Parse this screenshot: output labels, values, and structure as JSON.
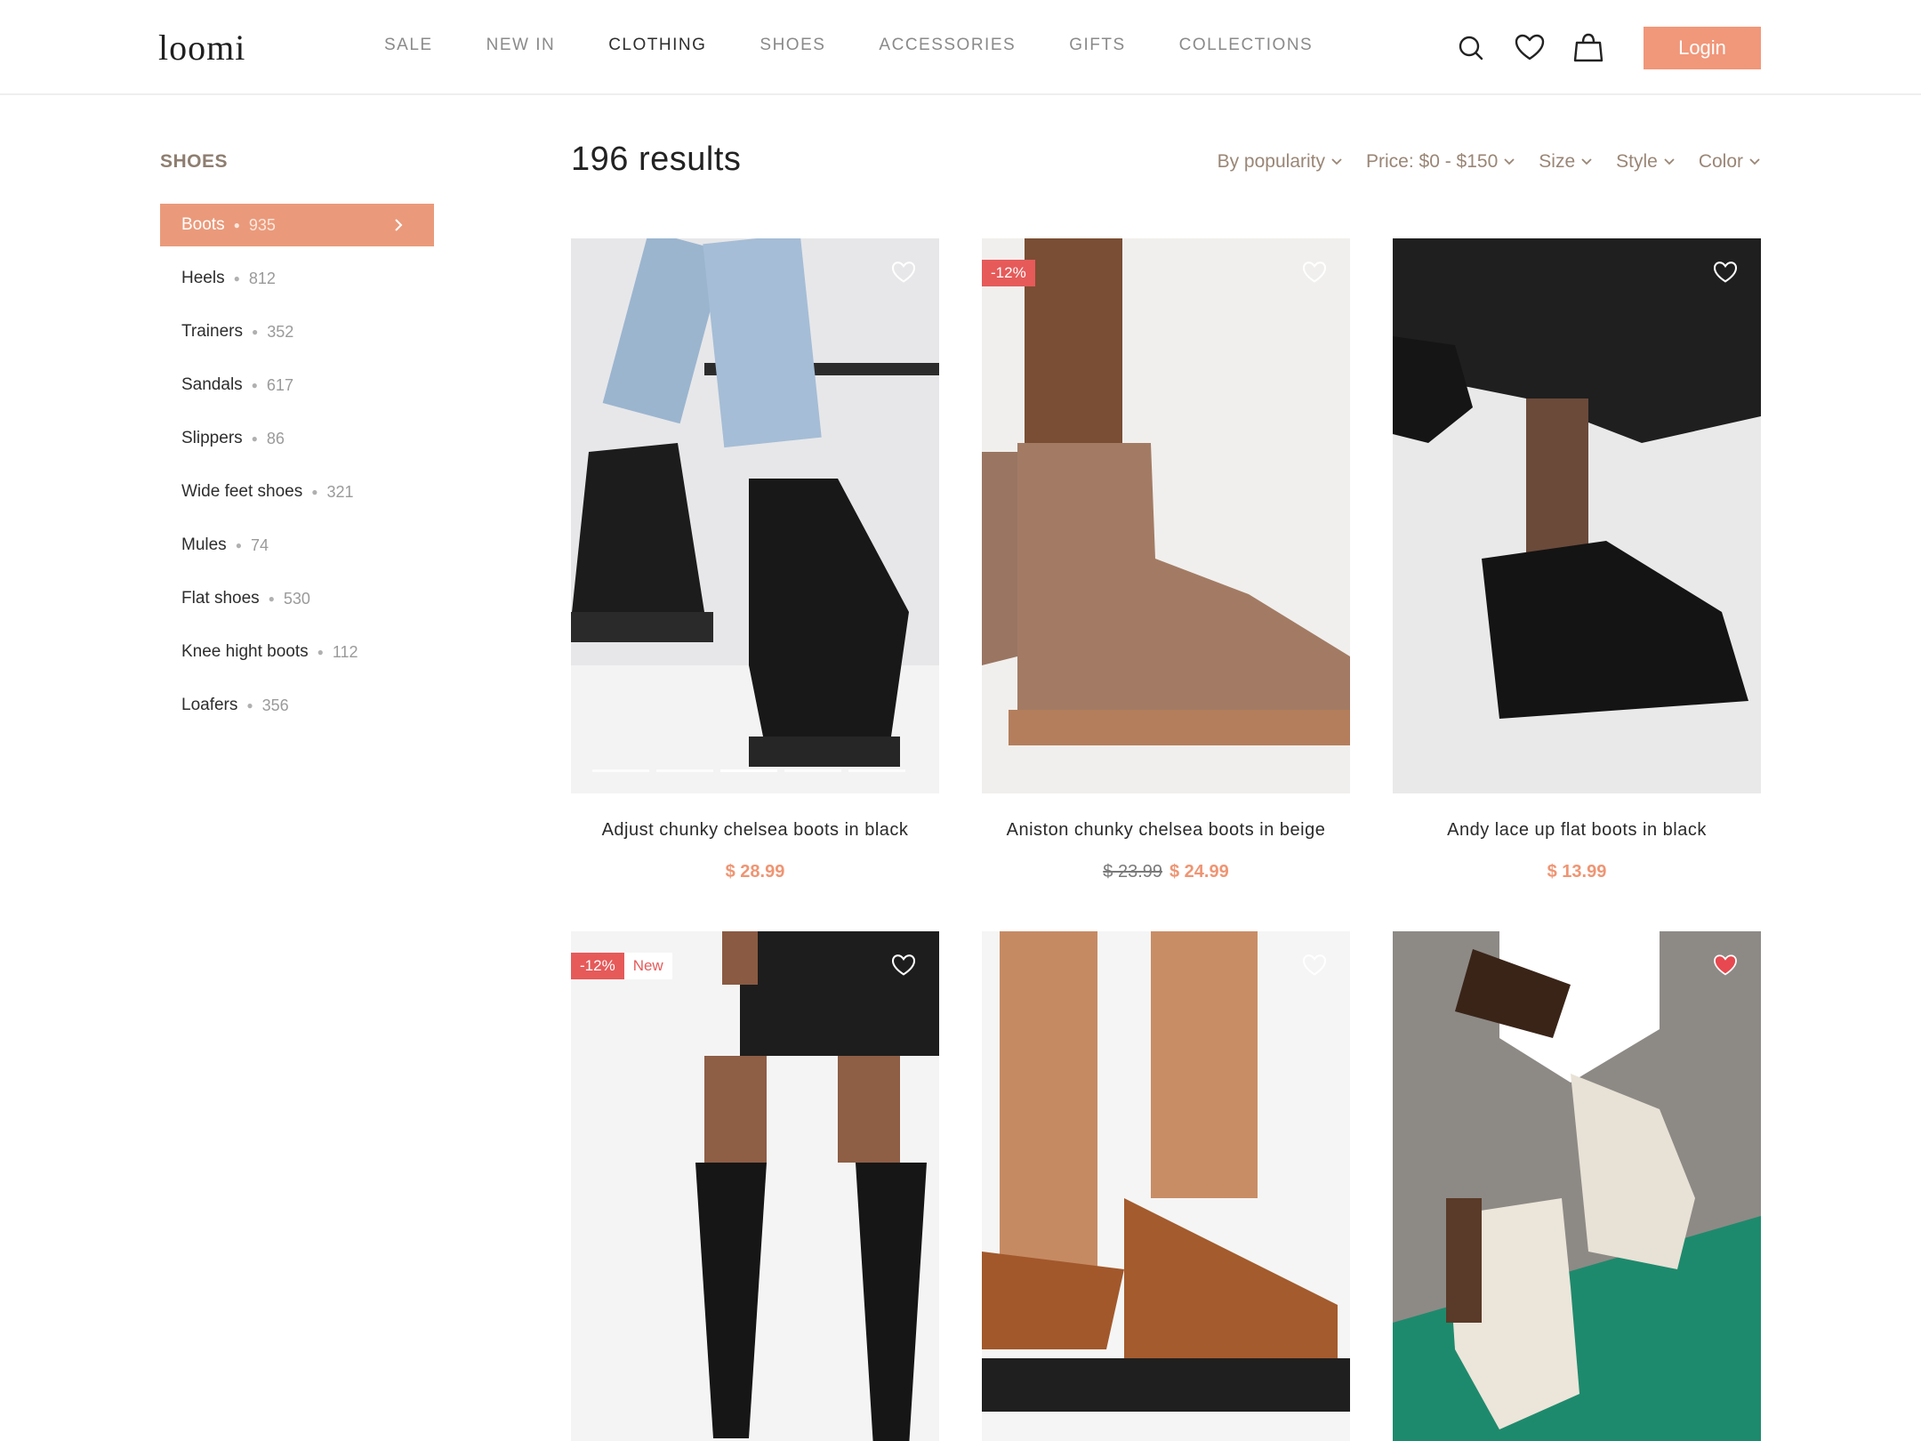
{
  "header": {
    "logo": "loomi",
    "nav": [
      "SALE",
      "NEW IN",
      "CLOTHING",
      "SHOES",
      "ACCESSORIES",
      "GIFTS",
      "COLLECTIONS"
    ],
    "active_nav": "CLOTHING",
    "login_label": "Login",
    "icons": [
      "search-icon",
      "heart-icon",
      "bag-icon"
    ]
  },
  "sidebar": {
    "title": "SHOES",
    "items": [
      {
        "label": "Boots",
        "count": "935",
        "active": true
      },
      {
        "label": "Heels",
        "count": "812"
      },
      {
        "label": "Trainers",
        "count": "352"
      },
      {
        "label": "Sandals",
        "count": "617"
      },
      {
        "label": "Slippers",
        "count": "86"
      },
      {
        "label": "Wide feet shoes",
        "count": "321"
      },
      {
        "label": "Mules",
        "count": "74"
      },
      {
        "label": "Flat shoes",
        "count": "530"
      },
      {
        "label": "Knee hight boots",
        "count": "112"
      },
      {
        "label": "Loafers",
        "count": "356"
      }
    ]
  },
  "main": {
    "results": "196 results",
    "filters": [
      "By popularity",
      "Price: $0 - $150",
      "Size",
      "Style",
      "Color"
    ],
    "products": [
      {
        "name": "Adjust chunky chelsea boots in black",
        "price": "$ 28.99",
        "old_price": "",
        "badge_sale": "",
        "badge_new": "",
        "liked": false
      },
      {
        "name": "Aniston chunky chelsea boots in beige",
        "price": "$ 24.99",
        "old_price": "$ 23.99",
        "badge_sale": "-12%",
        "badge_new": "",
        "liked": false
      },
      {
        "name": "Andy lace up flat boots in black",
        "price": "$ 13.99",
        "old_price": "",
        "badge_sale": "",
        "badge_new": "",
        "liked": false
      },
      {
        "name": "",
        "price": "",
        "old_price": "",
        "badge_sale": "-12%",
        "badge_new": "New",
        "liked": false
      },
      {
        "name": "",
        "price": "",
        "old_price": "",
        "badge_sale": "",
        "badge_new": "",
        "liked": false
      },
      {
        "name": "",
        "price": "",
        "old_price": "",
        "badge_sale": "",
        "badge_new": "",
        "liked": true
      }
    ]
  },
  "colors": {
    "accent": "#ea9a7b",
    "sale_badge": "#e65a5a",
    "price": "#ef9573"
  }
}
